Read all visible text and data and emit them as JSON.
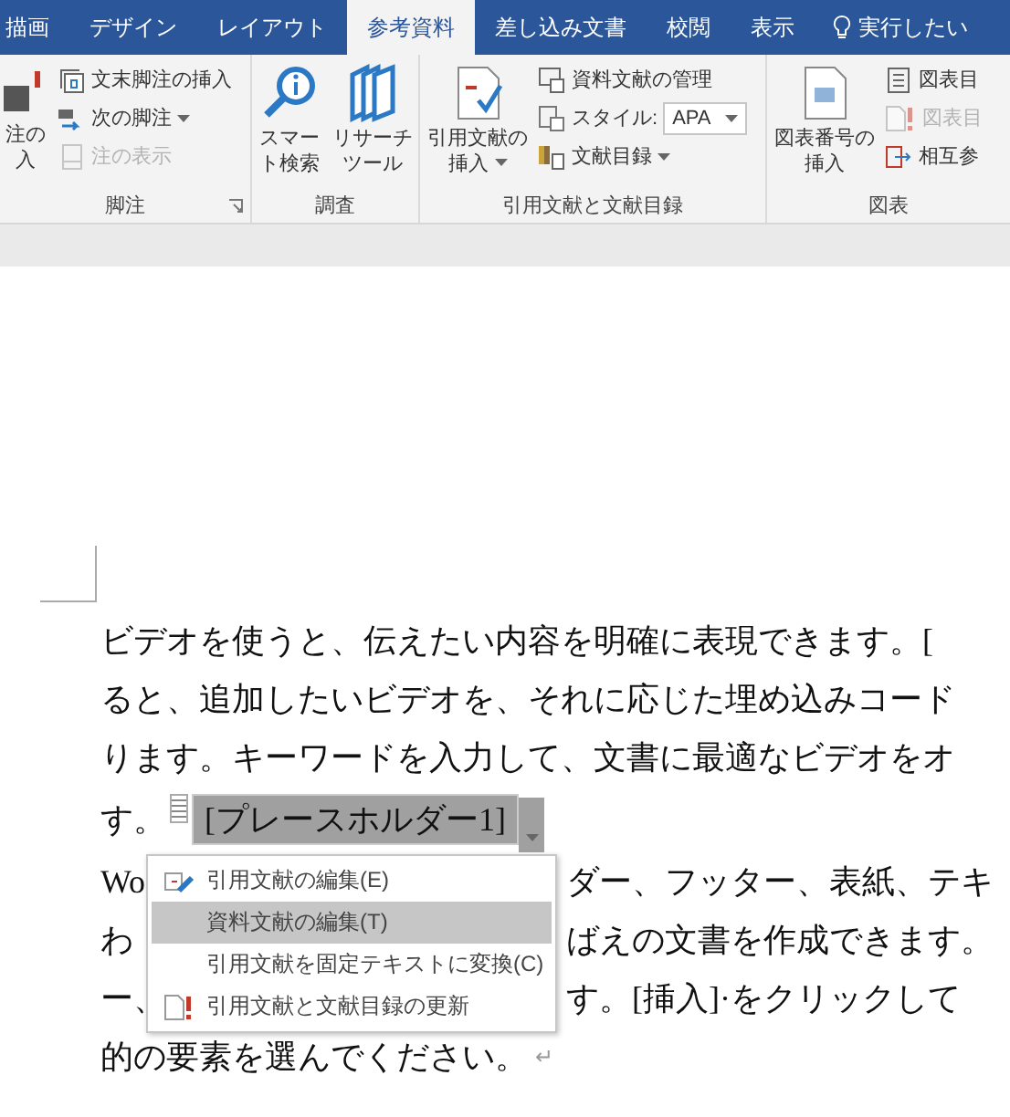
{
  "tabs": [
    {
      "label": "描画",
      "selected": false
    },
    {
      "label": "デザイン",
      "selected": false
    },
    {
      "label": "レイアウト",
      "selected": false
    },
    {
      "label": "参考資料",
      "selected": true
    },
    {
      "label": "差し込み文書",
      "selected": false
    },
    {
      "label": "校閲",
      "selected": false
    },
    {
      "label": "表示",
      "selected": false
    }
  ],
  "tell_me": {
    "label": "実行したい"
  },
  "ribbon": {
    "groups": [
      {
        "label": "脚注",
        "launcher": true,
        "large_buttons": [
          {
            "lines": [
              "注の",
              "入"
            ],
            "dropdown": false
          }
        ],
        "small_buttons": [
          {
            "kind": "button",
            "label": "文末脚注の挿入",
            "dropdown": false,
            "disabled": false
          },
          {
            "kind": "button",
            "label": "次の脚注",
            "dropdown": true,
            "disabled": false
          },
          {
            "kind": "button",
            "label": "注の表示",
            "dropdown": false,
            "disabled": true
          }
        ]
      },
      {
        "label": "調査",
        "launcher": false,
        "large_buttons": [
          {
            "lines": [
              "スマー",
              "ト検索"
            ],
            "dropdown": false
          },
          {
            "lines": [
              "リサーチ",
              "ツール"
            ],
            "dropdown": false
          }
        ]
      },
      {
        "label": "引用文献と文献目録",
        "launcher": false,
        "large_buttons": [
          {
            "lines": [
              "引用文献の",
              "挿入"
            ],
            "dropdown": true
          }
        ],
        "small_buttons": [
          {
            "kind": "button",
            "label": "資料文献の管理",
            "dropdown": false,
            "disabled": false
          },
          {
            "kind": "combo",
            "label": "スタイル:",
            "value": "APA"
          },
          {
            "kind": "button",
            "label": "文献目録",
            "dropdown": true,
            "disabled": false
          }
        ]
      },
      {
        "label": "図表",
        "launcher": false,
        "large_buttons": [
          {
            "lines": [
              "図表番号の",
              "挿入"
            ],
            "dropdown": false
          }
        ],
        "small_buttons": [
          {
            "kind": "button",
            "label": "図表目",
            "dropdown": false,
            "disabled": false
          },
          {
            "kind": "button",
            "label": "図表目",
            "dropdown": false,
            "disabled": true
          },
          {
            "kind": "button",
            "label": "相互参",
            "dropdown": false,
            "disabled": false
          }
        ]
      }
    ]
  },
  "document": {
    "lines": [
      {
        "kind": "text",
        "text": "ビデオを使うと、伝えたい内容を明確に表現できます。["
      },
      {
        "kind": "text",
        "text": "ると、追加したいビデオを、それに応じた埋め込みコード"
      },
      {
        "kind": "text",
        "text": "ります。キーワードを入力して、文書に最適なビデオをオ"
      },
      {
        "kind": "control",
        "text": "す。",
        "control_text": "[プレースホルダー1]"
      },
      {
        "kind": "split",
        "left": "Wo",
        "right": "ダー、フッター、表紙、テキ"
      },
      {
        "kind": "split",
        "left": "わ",
        "right": "ばえの文書を作成できます。"
      },
      {
        "kind": "split",
        "left": "ー、",
        "right": "す。[挿入]·をクリックして"
      },
      {
        "kind": "text",
        "text": "的の要素を選んでください。",
        "mark": "↵"
      }
    ]
  },
  "context_menu": {
    "items": [
      {
        "label": "引用文献の編集(E)",
        "selected": false
      },
      {
        "label": "資料文献の編集(T)",
        "selected": true
      },
      {
        "label": "引用文献を固定テキストに変換(C)",
        "selected": false
      },
      {
        "label": "引用文献と文献目録の更新",
        "selected": false
      }
    ]
  }
}
